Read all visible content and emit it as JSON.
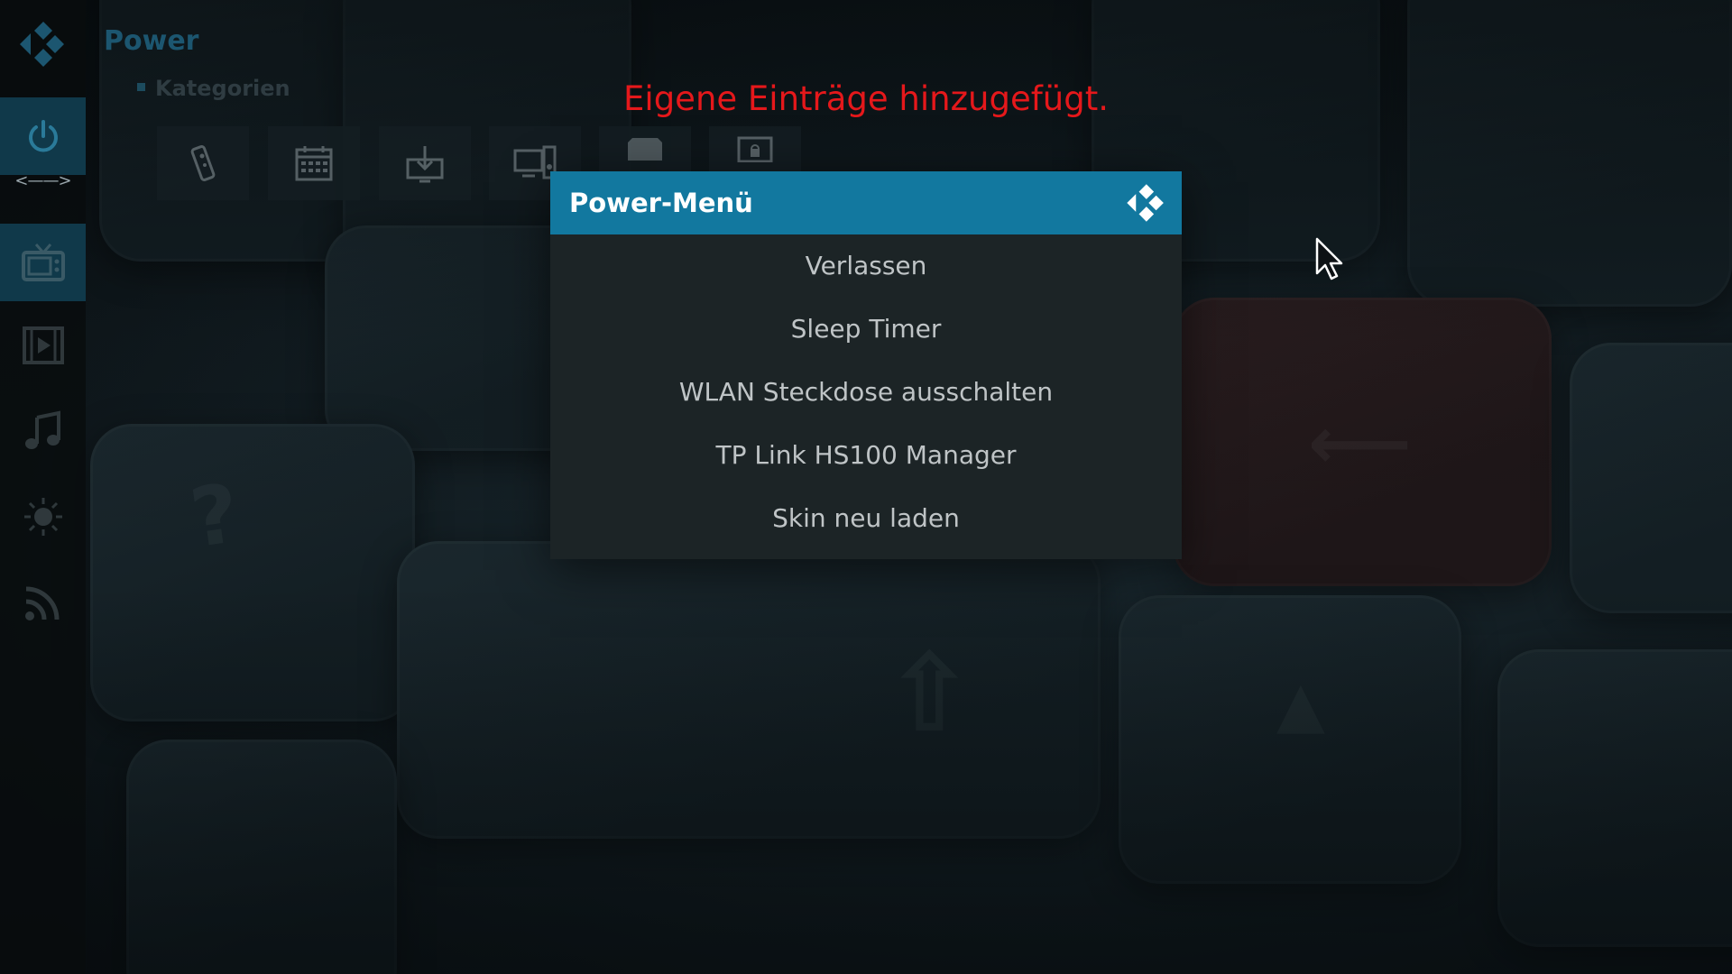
{
  "header": {
    "title": "Power",
    "breadcrumb": "Kategorien"
  },
  "annotation": "Eigene Einträge hinzugefügt.",
  "sidebar": {
    "items": [
      {
        "name": "power",
        "icon": "power-icon",
        "active": true
      },
      {
        "name": "tv",
        "icon": "tv-icon",
        "active": true
      },
      {
        "name": "movies",
        "icon": "film-icon",
        "active": false
      },
      {
        "name": "music",
        "icon": "music-note-icon",
        "active": false
      },
      {
        "name": "weather",
        "icon": "sun-icon",
        "active": false
      },
      {
        "name": "rss",
        "icon": "rss-icon",
        "active": false
      }
    ]
  },
  "categories": [
    {
      "icon": "remote-icon"
    },
    {
      "icon": "calendar-icon"
    },
    {
      "icon": "download-icon"
    },
    {
      "icon": "devices-icon"
    },
    {
      "icon": "folder-icon"
    },
    {
      "icon": "network-lock-icon"
    }
  ],
  "dialog": {
    "title": "Power-Menü",
    "items": [
      {
        "label": "Verlassen"
      },
      {
        "label": "Sleep Timer"
      },
      {
        "label": "WLAN Steckdose ausschalten"
      },
      {
        "label": "TP Link HS100 Manager"
      },
      {
        "label": "Skin neu laden"
      }
    ]
  },
  "colors": {
    "accent": "#12789f",
    "annotation": "#e5181b",
    "dialog_bg": "#1c2426",
    "menu_text": "#bfc4c6"
  }
}
